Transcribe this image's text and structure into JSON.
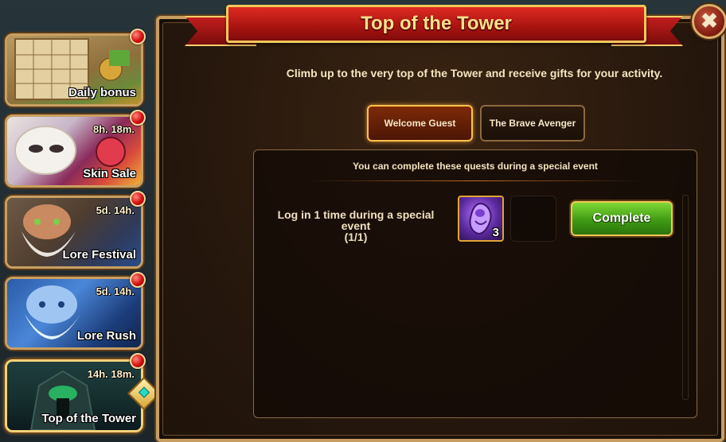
{
  "title": "Top of the Tower",
  "close_icon": "close-icon",
  "subtitle": "Climb up to the very top of the Tower and receive gifts for your activity.",
  "tabs": [
    {
      "label": "Welcome Guest",
      "active": true
    },
    {
      "label": "The Brave Avenger",
      "active": false
    }
  ],
  "quest_panel": {
    "note": "You can complete these quests during a special event",
    "quest_line1": "Log in 1 time during a special event",
    "quest_line2": "(1/1)",
    "reward_icon": "soul-stone-icon",
    "reward_count": "3",
    "complete_label": "Complete"
  },
  "sidebar": {
    "items": [
      {
        "label": "Daily bonus",
        "time": ""
      },
      {
        "label": "Skin Sale",
        "time": "8h. 18m."
      },
      {
        "label": "Lore Festival",
        "time": "5d. 14h."
      },
      {
        "label": "Lore Rush",
        "time": "5d. 14h."
      },
      {
        "label": "Top of the Tower",
        "time": "14h. 18m."
      }
    ]
  },
  "colors": {
    "ribbon": "#c21d1d",
    "gold_border": "#f1c85a",
    "complete_green": "#3f9a15",
    "notification_red": "#d40f0f"
  }
}
